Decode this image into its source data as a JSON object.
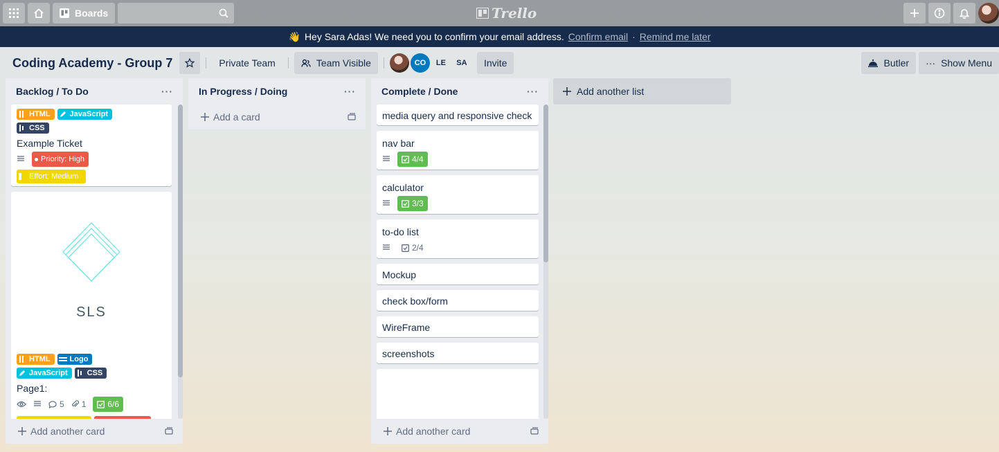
{
  "header": {
    "boards_label": "Boards",
    "logo_text": "Trello"
  },
  "banner": {
    "message": "Hey Sara Adas! We need you to confirm your email address.",
    "confirm_link": "Confirm email",
    "separator": "·",
    "remind_link": "Remind me later"
  },
  "board": {
    "title": "Coding Academy - Group 7",
    "team_label": "Private Team",
    "visibility_label": "Team Visible",
    "members": [
      "CO",
      "LE",
      "SA"
    ],
    "invite_label": "Invite",
    "butler_label": "Butler",
    "show_menu_label": "Show Menu"
  },
  "lists": [
    {
      "title": "Backlog / To Do",
      "more": "···",
      "footer": "Add another card",
      "cards": [
        {
          "labels": [
            "HTML",
            "JavaScript",
            "CSS"
          ],
          "title": "Example Ticket",
          "priority": "Priority: High",
          "effort": "Effort: Medium"
        },
        {
          "cover_text": "SLS",
          "labels": [
            "HTML",
            "Logo",
            "JavaScript",
            "CSS"
          ],
          "title": "Page1:",
          "comments": "5",
          "attachments": "1",
          "checklist": "6/6"
        }
      ]
    },
    {
      "title": "In Progress / Doing",
      "more": "···",
      "add_card": "Add a card"
    },
    {
      "title": "Complete / Done",
      "more": "···",
      "footer": "Add another card",
      "cards": [
        {
          "title": "media query and responsive check"
        },
        {
          "title": "nav bar",
          "checklist": "4/4"
        },
        {
          "title": "calculator",
          "checklist": "3/3"
        },
        {
          "title": "to-do list",
          "checklist": "2/4"
        },
        {
          "title": "Mockup"
        },
        {
          "title": "check box/form"
        },
        {
          "title": "WireFrame"
        },
        {
          "title": "screenshots"
        }
      ]
    }
  ],
  "add_list_label": "Add another list",
  "colors": {
    "banner": "#172b4d",
    "green": "#61bd4f",
    "orange": "#ff9f1a",
    "sky": "#00c2e0",
    "navy": "#344563",
    "blue": "#0079bf",
    "red": "#eb5a46",
    "yellow": "#f2d600"
  }
}
